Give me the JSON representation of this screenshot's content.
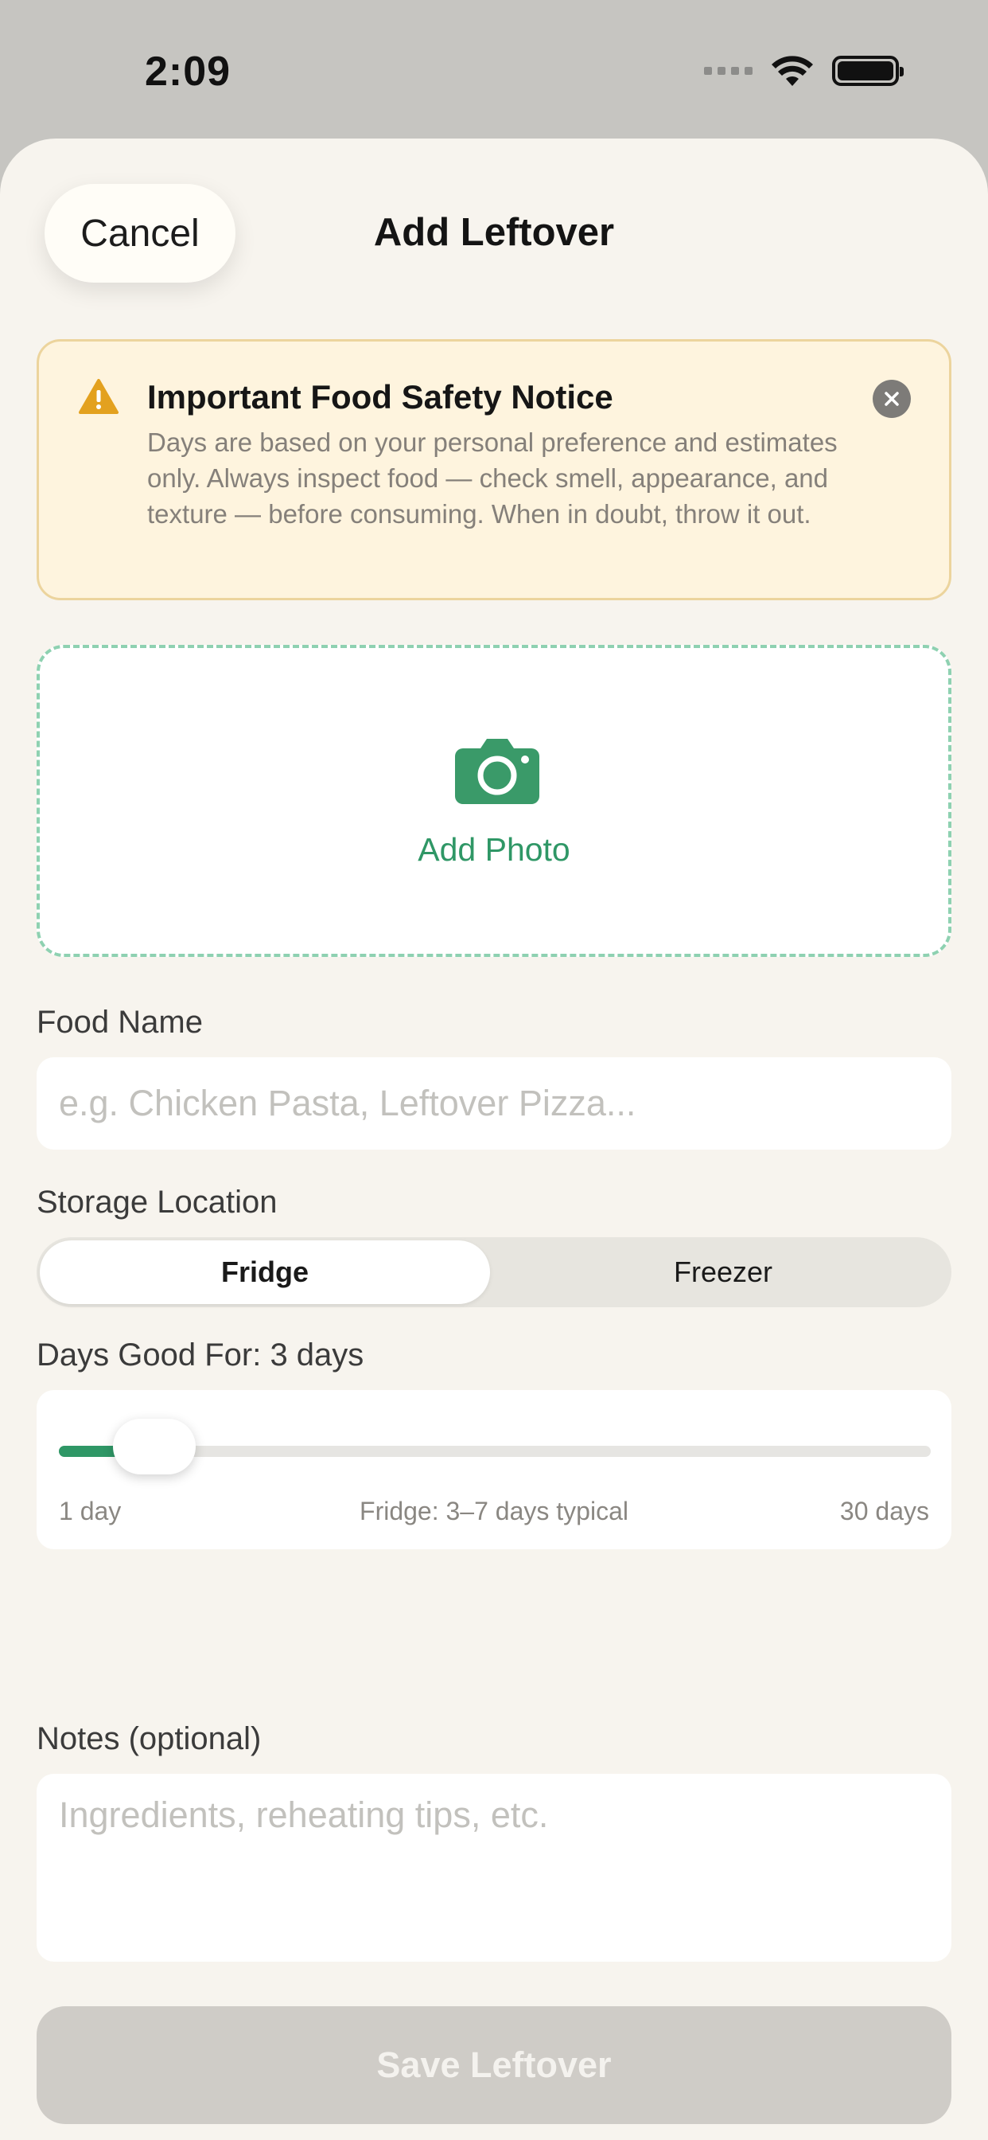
{
  "status": {
    "time": "2:09"
  },
  "header": {
    "cancel_label": "Cancel",
    "title": "Add Leftover"
  },
  "notice": {
    "title": "Important Food Safety Notice",
    "body": "Days are based on your personal preference and estimates only. Always inspect food — check smell, appearance, and texture — before consuming. When in doubt, throw it out."
  },
  "photo": {
    "label": "Add Photo",
    "icon": "camera-icon"
  },
  "food_name": {
    "label": "Food Name",
    "placeholder": "e.g. Chicken Pasta, Leftover Pizza...",
    "value": ""
  },
  "storage": {
    "label": "Storage Location",
    "options": [
      "Fridge",
      "Freezer"
    ],
    "selected": "Fridge"
  },
  "days": {
    "label": "Days Good For: 3 days",
    "value": 3,
    "min": 1,
    "max": 30,
    "min_label": "1 day",
    "hint": "Fridge: 3–7 days typical",
    "max_label": "30 days"
  },
  "notes": {
    "label": "Notes (optional)",
    "placeholder": "Ingredients, reheating tips, etc.",
    "value": ""
  },
  "save": {
    "label": "Save Leftover",
    "enabled": false
  },
  "colors": {
    "accent": "#2f9766",
    "warning": "#e3a11f",
    "notice_bg": "#fef4de",
    "sheet_bg": "#f7f4ee",
    "disabled_button": "#cfccc7"
  }
}
